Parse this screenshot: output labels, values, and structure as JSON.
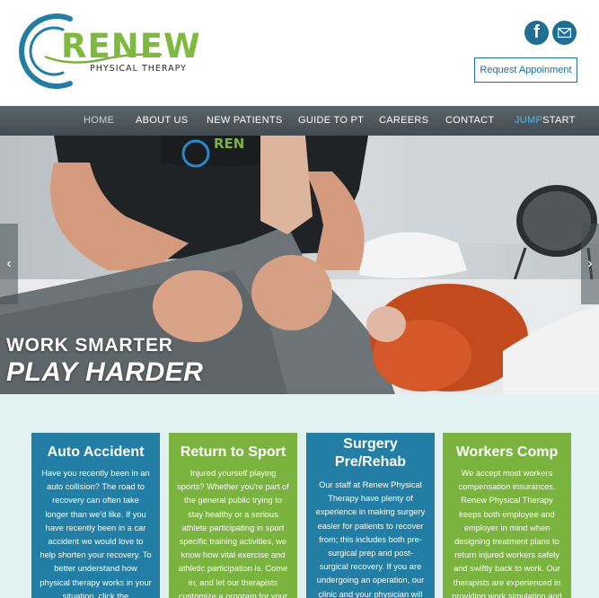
{
  "brand": {
    "name": "RENEW",
    "tagline": "PHYSICAL THERAPY",
    "colors": {
      "green": "#7ab33e",
      "blue": "#237ea6",
      "nav": "#4b545b",
      "accent": "#4fb3e8"
    }
  },
  "header": {
    "social": [
      {
        "icon": "facebook-icon",
        "glyph": "f"
      },
      {
        "icon": "mail-icon"
      }
    ],
    "request_button": "Request Appoinment"
  },
  "nav": {
    "items": [
      {
        "label": "HOME",
        "active": true
      },
      {
        "label": "ABOUT US"
      },
      {
        "label": "NEW PATIENTS"
      },
      {
        "label": "GUIDE TO PT"
      },
      {
        "label": "CAREERS"
      },
      {
        "label": "CONTACT"
      }
    ],
    "jumpstart": {
      "accent": "JUMP",
      "rest": "START"
    }
  },
  "hero": {
    "line1": "WORK SMARTER",
    "line2": "PLAY HARDER",
    "prev_arrow": "‹",
    "next_arrow": "›"
  },
  "services": [
    {
      "title": "Auto Accident",
      "body": "Have you recently been in an auto collision? The road to recovery can often take longer than we'd like. If you have recently been in a car accident we would love to help shorten your recovery. To better understand how physical therapy works in your situation, click the"
    },
    {
      "title": "Return to Sport",
      "body": "Injured yourself playing sports? Whether you're part of the general public trying to stay healthy or a serious athlete participating in sport specific training activities, we know how vital exercise and athletic participation is. Come in; and let our therapists customize a program for your"
    },
    {
      "title": "Surgery Pre/Rehab",
      "body": "Our staff at Renew Physical Therapy have plenty of experience in making surgery easier for patients to recover from; this includes both pre-surgical prep and post-surgical recovery. If you are undergoing an operation, our clinic and your physician will"
    },
    {
      "title": "Workers Comp",
      "body": "We accept most workers compensation insurances. Renew Physical Therapy keeps both employee and employer in mind when designing treatment plans to return injured workers safely and swiftly back to work. Our therapists are experienced in providing work simulation and"
    }
  ]
}
